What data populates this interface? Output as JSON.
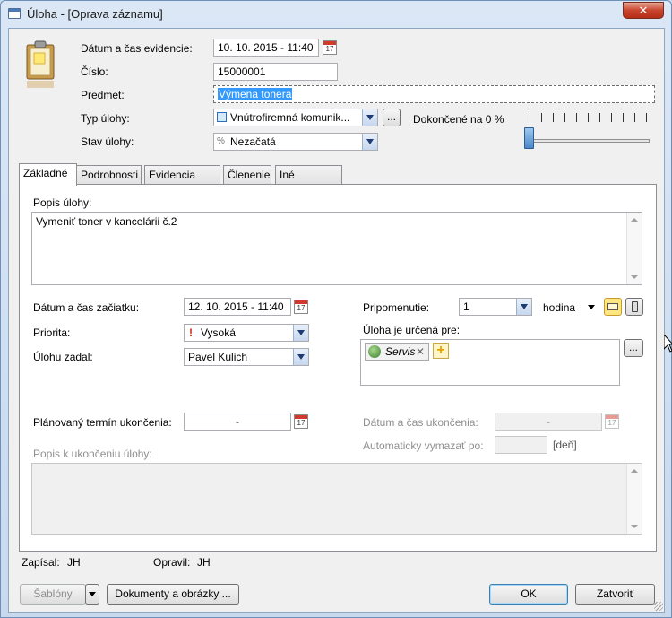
{
  "window": {
    "title": "Úloha - [Oprava záznamu]",
    "close_glyph": "✕"
  },
  "header": {
    "labels": {
      "datum_evidencie": "Dátum a čas evidencie:",
      "cislo": "Číslo:",
      "predmet": "Predmet:",
      "typ_ulohy": "Typ úlohy:",
      "stav_ulohy": "Stav úlohy:",
      "dokoncene": "Dokončené na 0 %"
    },
    "values": {
      "datum_evidencie": "10. 10. 2015   - 11:40",
      "cislo": "15000001",
      "predmet": "Výmena tonera",
      "typ_ulohy": "Vnútrofiremná komunik...",
      "stav_ulohy": "Nezačatá"
    },
    "more_button": "...",
    "progress_percent": 0
  },
  "tabs": [
    {
      "label": "Základné",
      "active": true
    },
    {
      "label": "Podrobnosti"
    },
    {
      "label": "Evidencia času"
    },
    {
      "label": "Členenie"
    },
    {
      "label": "Iné záznamy"
    }
  ],
  "basic": {
    "popis_label": "Popis úlohy:",
    "popis_value": "Vymeniť toner v kancelárii č.2",
    "datum_zaciatku_label": "Dátum a čas začiatku:",
    "datum_zaciatku_value": "12. 10. 2015   - 11:40",
    "priorita_label": "Priorita:",
    "priorita_value": "Vysoká",
    "zadal_label": "Úlohu zadal:",
    "zadal_value": "Pavel Kulich",
    "pripomenutie_label": "Pripomenutie:",
    "pripomenutie_value": "1",
    "pripomenutie_unit": "hodina",
    "urcena_label": "Úloha je určená pre:",
    "urcena_token": "Servis",
    "urcena_more": "...",
    "planovany_label": "Plánovaný termín ukončenia:",
    "planovany_value": "-",
    "datum_ukoncenia_label": "Dátum a čas ukončenia:",
    "datum_ukoncenia_value": "-",
    "vymazat_label": "Automaticky vymazať po:",
    "vymazat_unit": "[deň]",
    "popis_ukoncenia_label": "Popis k ukončeniu úlohy:"
  },
  "footer": {
    "zapisal_label": "Zapísal:",
    "zapisal_value": "JH",
    "opravil_label": "Opravil:",
    "opravil_value": "JH",
    "sablony_button": "Šablóny",
    "dokumenty_button": "Dokumenty a obrázky ...",
    "ok_button": "OK",
    "zatvorit_button": "Zatvoriť"
  },
  "calendar_glyph": "17",
  "colors": {
    "accent": "#3c7fb1",
    "priority_high": "#d12a1a",
    "selection": "#3399ff"
  }
}
